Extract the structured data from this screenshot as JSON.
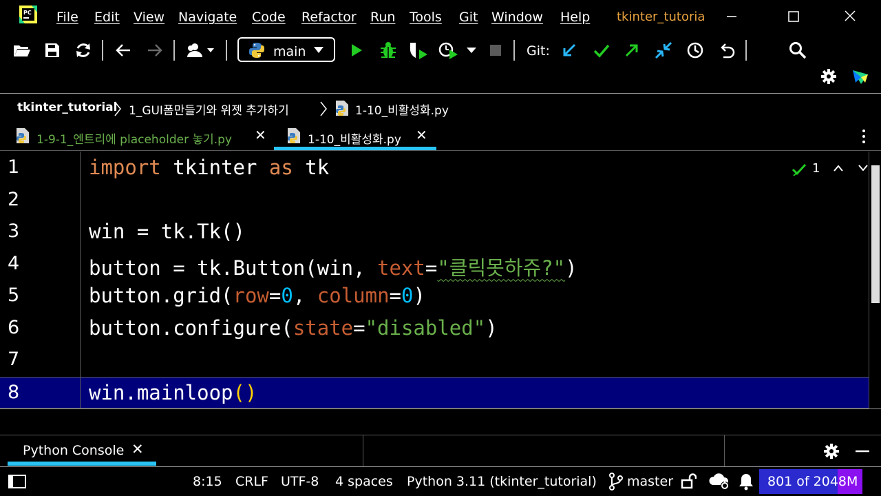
{
  "menubar": {
    "items": [
      "File",
      "Edit",
      "View",
      "Navigate",
      "Code",
      "Refactor",
      "Run",
      "Tools",
      "Git",
      "Window",
      "Help"
    ],
    "project_title": "tkinter_tutoria"
  },
  "toolbar": {
    "branch": "main",
    "git_label": "Git:",
    "icons": [
      "open-folder-icon",
      "save-icon",
      "sync-icon",
      "back-icon",
      "forward-icon",
      "user-icon",
      "python-icon",
      "run-icon",
      "debug-icon",
      "coverage-icon",
      "profile-icon",
      "more-run-icon",
      "stop-icon",
      "git-update-icon",
      "git-commit-icon",
      "git-push-icon",
      "git-merge-icon",
      "history-icon",
      "rollback-icon",
      "search-icon",
      "settings-icon",
      "jetbrains-icon"
    ]
  },
  "breadcrumb": {
    "items": [
      "tkinter_tutorial",
      "1_GUI폼만들기와 위젯 추가하기",
      "1-10_비활성화.py"
    ]
  },
  "tabs": [
    {
      "label": "1-9-1_엔트리에 placeholder 놓기.py",
      "active": false
    },
    {
      "label": "1-10_비활성화.py",
      "active": true
    }
  ],
  "editor": {
    "inspection_count": "1",
    "lines": [
      {
        "n": "1",
        "tokens": [
          {
            "t": "import",
            "c": "kw"
          },
          {
            "t": " tkinter ",
            "c": ""
          },
          {
            "t": "as",
            "c": "kw"
          },
          {
            "t": " tk",
            "c": ""
          }
        ]
      },
      {
        "n": "2",
        "tokens": []
      },
      {
        "n": "3",
        "tokens": [
          {
            "t": "win = tk.Tk()",
            "c": ""
          }
        ]
      },
      {
        "n": "4",
        "tokens": [
          {
            "t": "button = tk.Button(win, ",
            "c": ""
          },
          {
            "t": "text",
            "c": "param"
          },
          {
            "t": "=",
            "c": ""
          },
          {
            "t": "\"클릭못하쥬?\"",
            "c": "str squiggle"
          },
          {
            "t": ")",
            "c": ""
          }
        ]
      },
      {
        "n": "5",
        "tokens": [
          {
            "t": "button.grid(",
            "c": ""
          },
          {
            "t": "row",
            "c": "param"
          },
          {
            "t": "=",
            "c": ""
          },
          {
            "t": "0",
            "c": "num"
          },
          {
            "t": ", ",
            "c": ""
          },
          {
            "t": "column",
            "c": "param"
          },
          {
            "t": "=",
            "c": ""
          },
          {
            "t": "0",
            "c": "num"
          },
          {
            "t": ")",
            "c": ""
          }
        ]
      },
      {
        "n": "6",
        "tokens": [
          {
            "t": "button.configure(",
            "c": ""
          },
          {
            "t": "state",
            "c": "param"
          },
          {
            "t": "=",
            "c": ""
          },
          {
            "t": "\"disabled\"",
            "c": "str"
          },
          {
            "t": ")",
            "c": ""
          }
        ]
      },
      {
        "n": "7",
        "tokens": []
      },
      {
        "n": "8",
        "tokens": [
          {
            "t": "win.mainloop",
            "c": ""
          },
          {
            "t": "()",
            "c": "paren"
          }
        ],
        "current": true
      }
    ]
  },
  "tool_window": {
    "tab_label": "Python Console",
    "close": "✕"
  },
  "statusbar": {
    "position": "8:15",
    "line_ending": "CRLF",
    "encoding": "UTF-8",
    "indent": "4 spaces",
    "interpreter": "Python 3.11 (tkinter_tutorial)",
    "branch": "master",
    "memory_text": "801 of 2048M",
    "memory_used_fraction": 0.39
  },
  "colors": {
    "accent_tab": "#29c4f5",
    "keyword": "#e08a53",
    "param": "#c65d32",
    "string": "#6ab04c",
    "number": "#00bfff",
    "current_line": "#00007a",
    "run_green": "#22cc22"
  }
}
